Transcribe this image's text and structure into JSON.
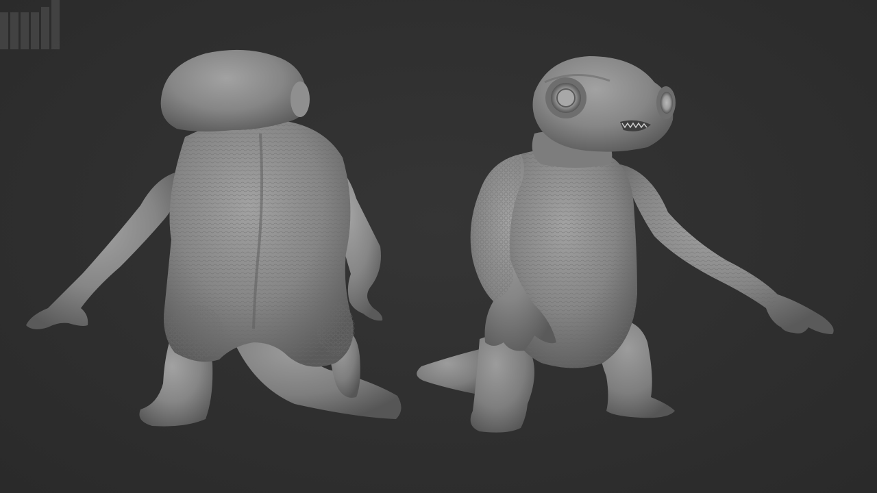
{
  "scene": {
    "background_color": "#2f2f2f",
    "clay_color": "#8a8a8a",
    "figures": [
      {
        "view": "back",
        "subject": "creature-sculpt"
      },
      {
        "view": "front-three-quarter",
        "subject": "creature-sculpt"
      }
    ],
    "watermark_icon": "bar-logo-icon"
  }
}
